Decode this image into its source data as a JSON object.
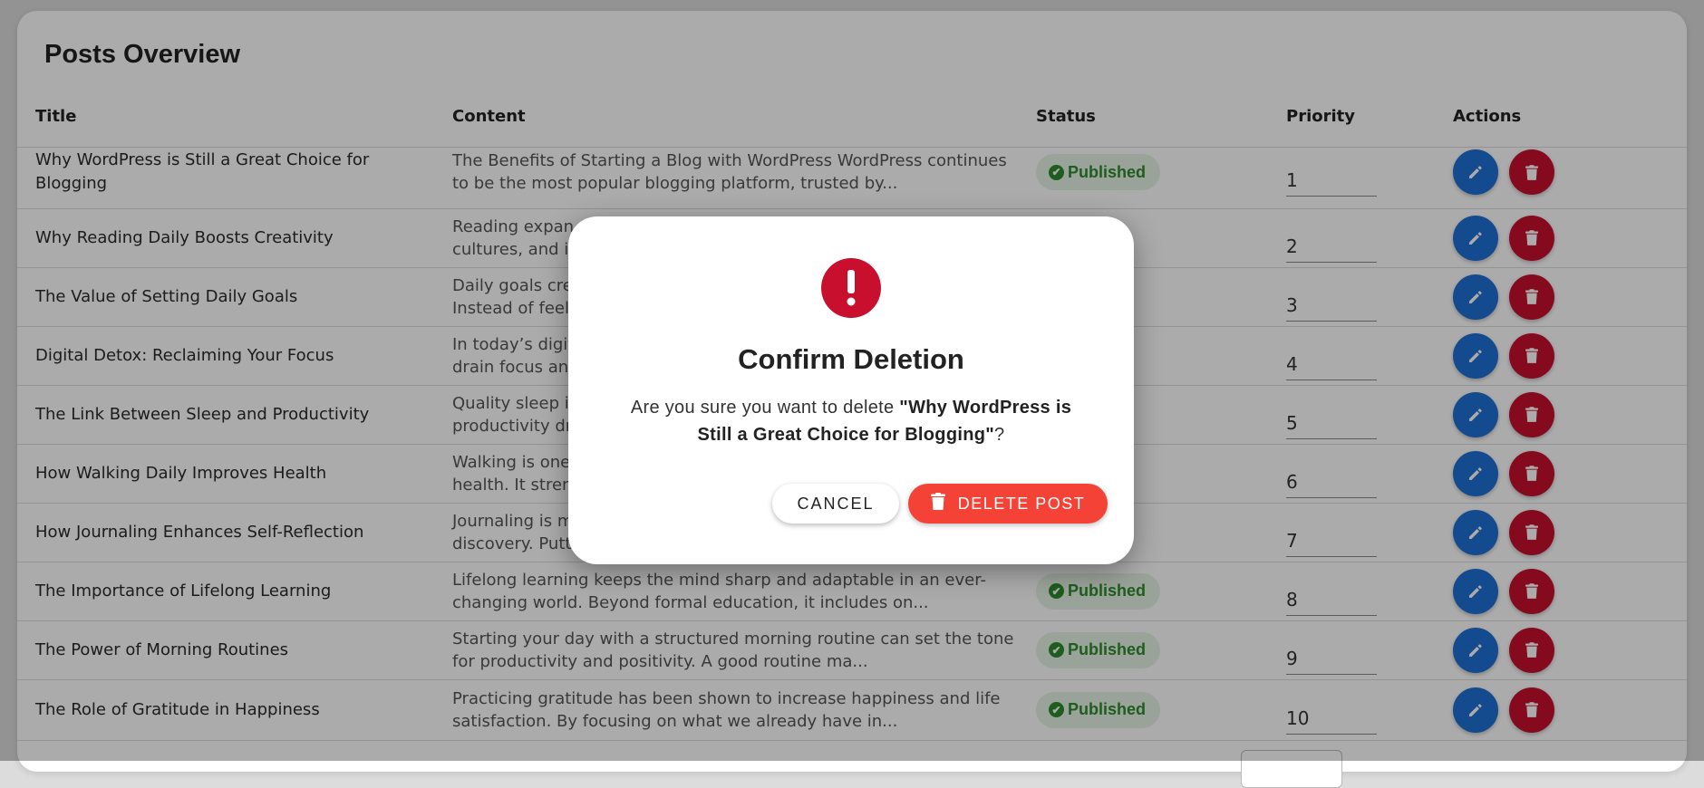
{
  "page": {
    "title": "Posts Overview"
  },
  "table": {
    "headers": {
      "title": "Title",
      "content": "Content",
      "status": "Status",
      "priority": "Priority",
      "actions": "Actions"
    },
    "rows": [
      {
        "title": "Why WordPress is Still a Great Choice for Blogging",
        "content": "The Benefits of Starting a Blog with WordPress WordPress continues to be the most popular blogging platform, trusted by...",
        "status": "Published",
        "priority": "1"
      },
      {
        "title": "Why Reading Daily Boosts Creativity",
        "content": "Reading expan\ncultures, and id",
        "status": "",
        "priority": "2"
      },
      {
        "title": "The Value of Setting Daily Goals",
        "content": "Daily goals cre\nInstead of feeli",
        "status": "",
        "priority": "3"
      },
      {
        "title": "Digital Detox: Reclaiming Your Focus",
        "content": "In today’s digit\ndrain focus and",
        "status": "",
        "priority": "4"
      },
      {
        "title": "The Link Between Sleep and Productivity",
        "content": "Quality sleep is\nproductivity dr",
        "status": "",
        "priority": "5"
      },
      {
        "title": "How Walking Daily Improves Health",
        "content": "Walking is one\nhealth. It streng",
        "status": "",
        "priority": "6"
      },
      {
        "title": "How Journaling Enhances Self-Reflection",
        "content": "Journaling is m\ndiscovery. Putt",
        "status": "",
        "priority": "7"
      },
      {
        "title": "The Importance of Lifelong Learning",
        "content": "Lifelong learning keeps the mind sharp and adaptable in an ever-changing world. Beyond formal education, it includes on...",
        "status": "Published",
        "priority": "8"
      },
      {
        "title": "The Power of Morning Routines",
        "content": "Starting your day with a structured morning routine can set the tone for productivity and positivity. A good routine ma...",
        "status": "Published",
        "priority": "9"
      },
      {
        "title": "The Role of Gratitude in Happiness",
        "content": "Practicing gratitude has been shown to increase happiness and life satisfaction. By focusing on what we already have in...",
        "status": "Published",
        "priority": "10"
      }
    ]
  },
  "dialog": {
    "title": "Confirm Deletion",
    "message_prefix": "Are you sure you want to delete ",
    "post_name": "\"Why WordPress is Still a Great Choice for Blogging\"",
    "message_suffix": "?",
    "cancel_label": "CANCEL",
    "delete_label": "DELETE POST"
  },
  "icons": {
    "status": "check-circle-icon",
    "edit": "pencil-icon",
    "delete": "trash-icon",
    "warning": "exclamation-icon"
  },
  "colors": {
    "edit_button": "#1f6fd4",
    "delete_row_button": "#c8102e",
    "delete_post_button": "#f44336",
    "published_badge_bg": "#e6f3e6",
    "published_badge_text": "#2e8b2e",
    "warning_icon": "#c8102e"
  }
}
